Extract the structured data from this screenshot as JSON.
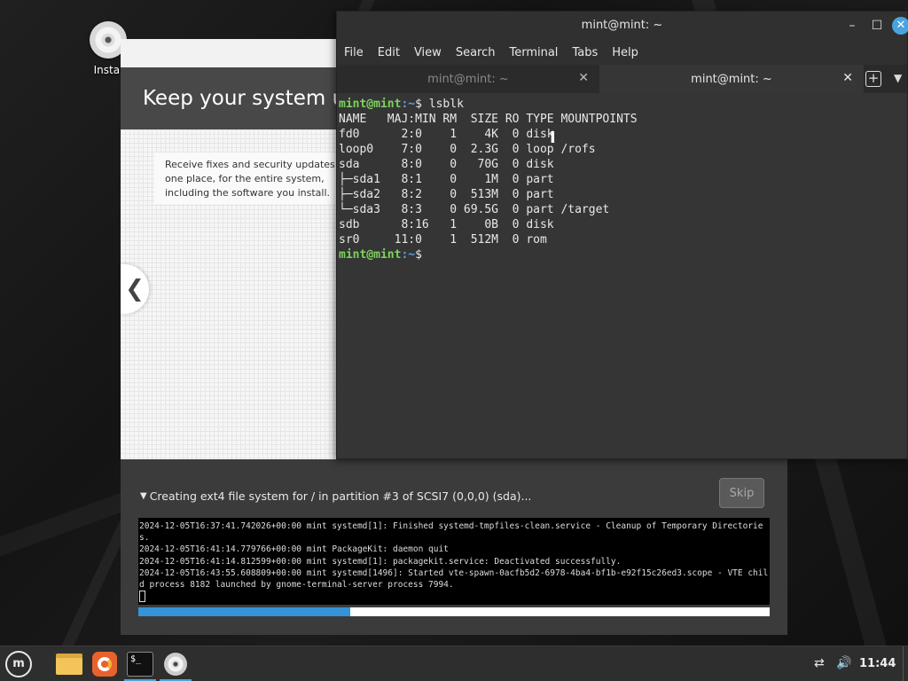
{
  "desktop": {
    "icon_label": "Instal"
  },
  "installer": {
    "slide_title": "Keep your system up",
    "slide_text": "Receive fixes and security updates\none place, for the entire system,\nincluding the software you install.",
    "prev_arrow": "❮",
    "status_text": "Creating ext4 file system for / in partition #3 of SCSI7 (0,0,0) (sda)...",
    "skip_label": "Skip",
    "progress": 0.335,
    "log_lines": [
      "2024-12-05T16:37:41.742026+00:00 mint systemd[1]: Finished systemd-tmpfiles-clean.service - Cleanup of Temporary Directories.",
      "2024-12-05T16:41:14.779766+00:00 mint PackageKit: daemon quit",
      "2024-12-05T16:41:14.812599+00:00 mint systemd[1]: packagekit.service: Deactivated successfully.",
      "2024-12-05T16:43:55.608809+00:00 mint systemd[1496]: Started vte-spawn-0acfb5d2-6978-4ba4-bf1b-e92f15c26ed3.scope - VTE child process 8182 launched by gnome-terminal-server process 7994."
    ]
  },
  "terminal": {
    "title": "mint@mint: ~",
    "menu": [
      "File",
      "Edit",
      "View",
      "Search",
      "Terminal",
      "Tabs",
      "Help"
    ],
    "tabs": [
      {
        "label": "mint@mint: ~",
        "active": false
      },
      {
        "label": "mint@mint: ~",
        "active": true
      }
    ],
    "prompt_user": "mint@mint",
    "prompt_path": ":~",
    "prompt_symbol": "$ ",
    "command": "lsblk",
    "output": [
      "NAME   MAJ:MIN RM  SIZE RO TYPE MOUNTPOINTS",
      "fd0      2:0    1    4K  0 disk",
      "loop0    7:0    0  2.3G  0 loop /rofs",
      "sda      8:0    0   70G  0 disk",
      "├─sda1   8:1    0    1M  0 part",
      "├─sda2   8:2    0  513M  0 part",
      "└─sda3   8:3    0 69.5G  0 part /target",
      "sdb      8:16   1    0B  0 disk",
      "sr0     11:0    1  512M  0 rom"
    ]
  },
  "taskbar": {
    "mint_logo": "m",
    "terminal_icon_text": "$_",
    "clock": "11:44",
    "network_icon": "⇄",
    "volume_icon": "🔊"
  }
}
